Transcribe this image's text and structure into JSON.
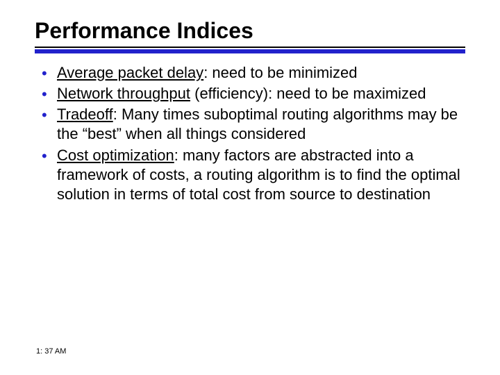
{
  "title": "Performance Indices",
  "accent_color": "#2222cc",
  "bullets": [
    {
      "term": "Average packet delay",
      "rest": ": need to be minimized"
    },
    {
      "term": "Network throughput",
      "rest": " (efficiency): need to be maximized"
    },
    {
      "term": "Tradeoff",
      "rest": ": Many times suboptimal routing algorithms may be the “best” when all things considered"
    },
    {
      "term": "Cost optimization",
      "rest": ": many factors are abstracted into a framework of costs, a routing algorithm is to find the optimal solution in terms of total cost from source to destination"
    }
  ],
  "timestamp": "1: 37 AM"
}
